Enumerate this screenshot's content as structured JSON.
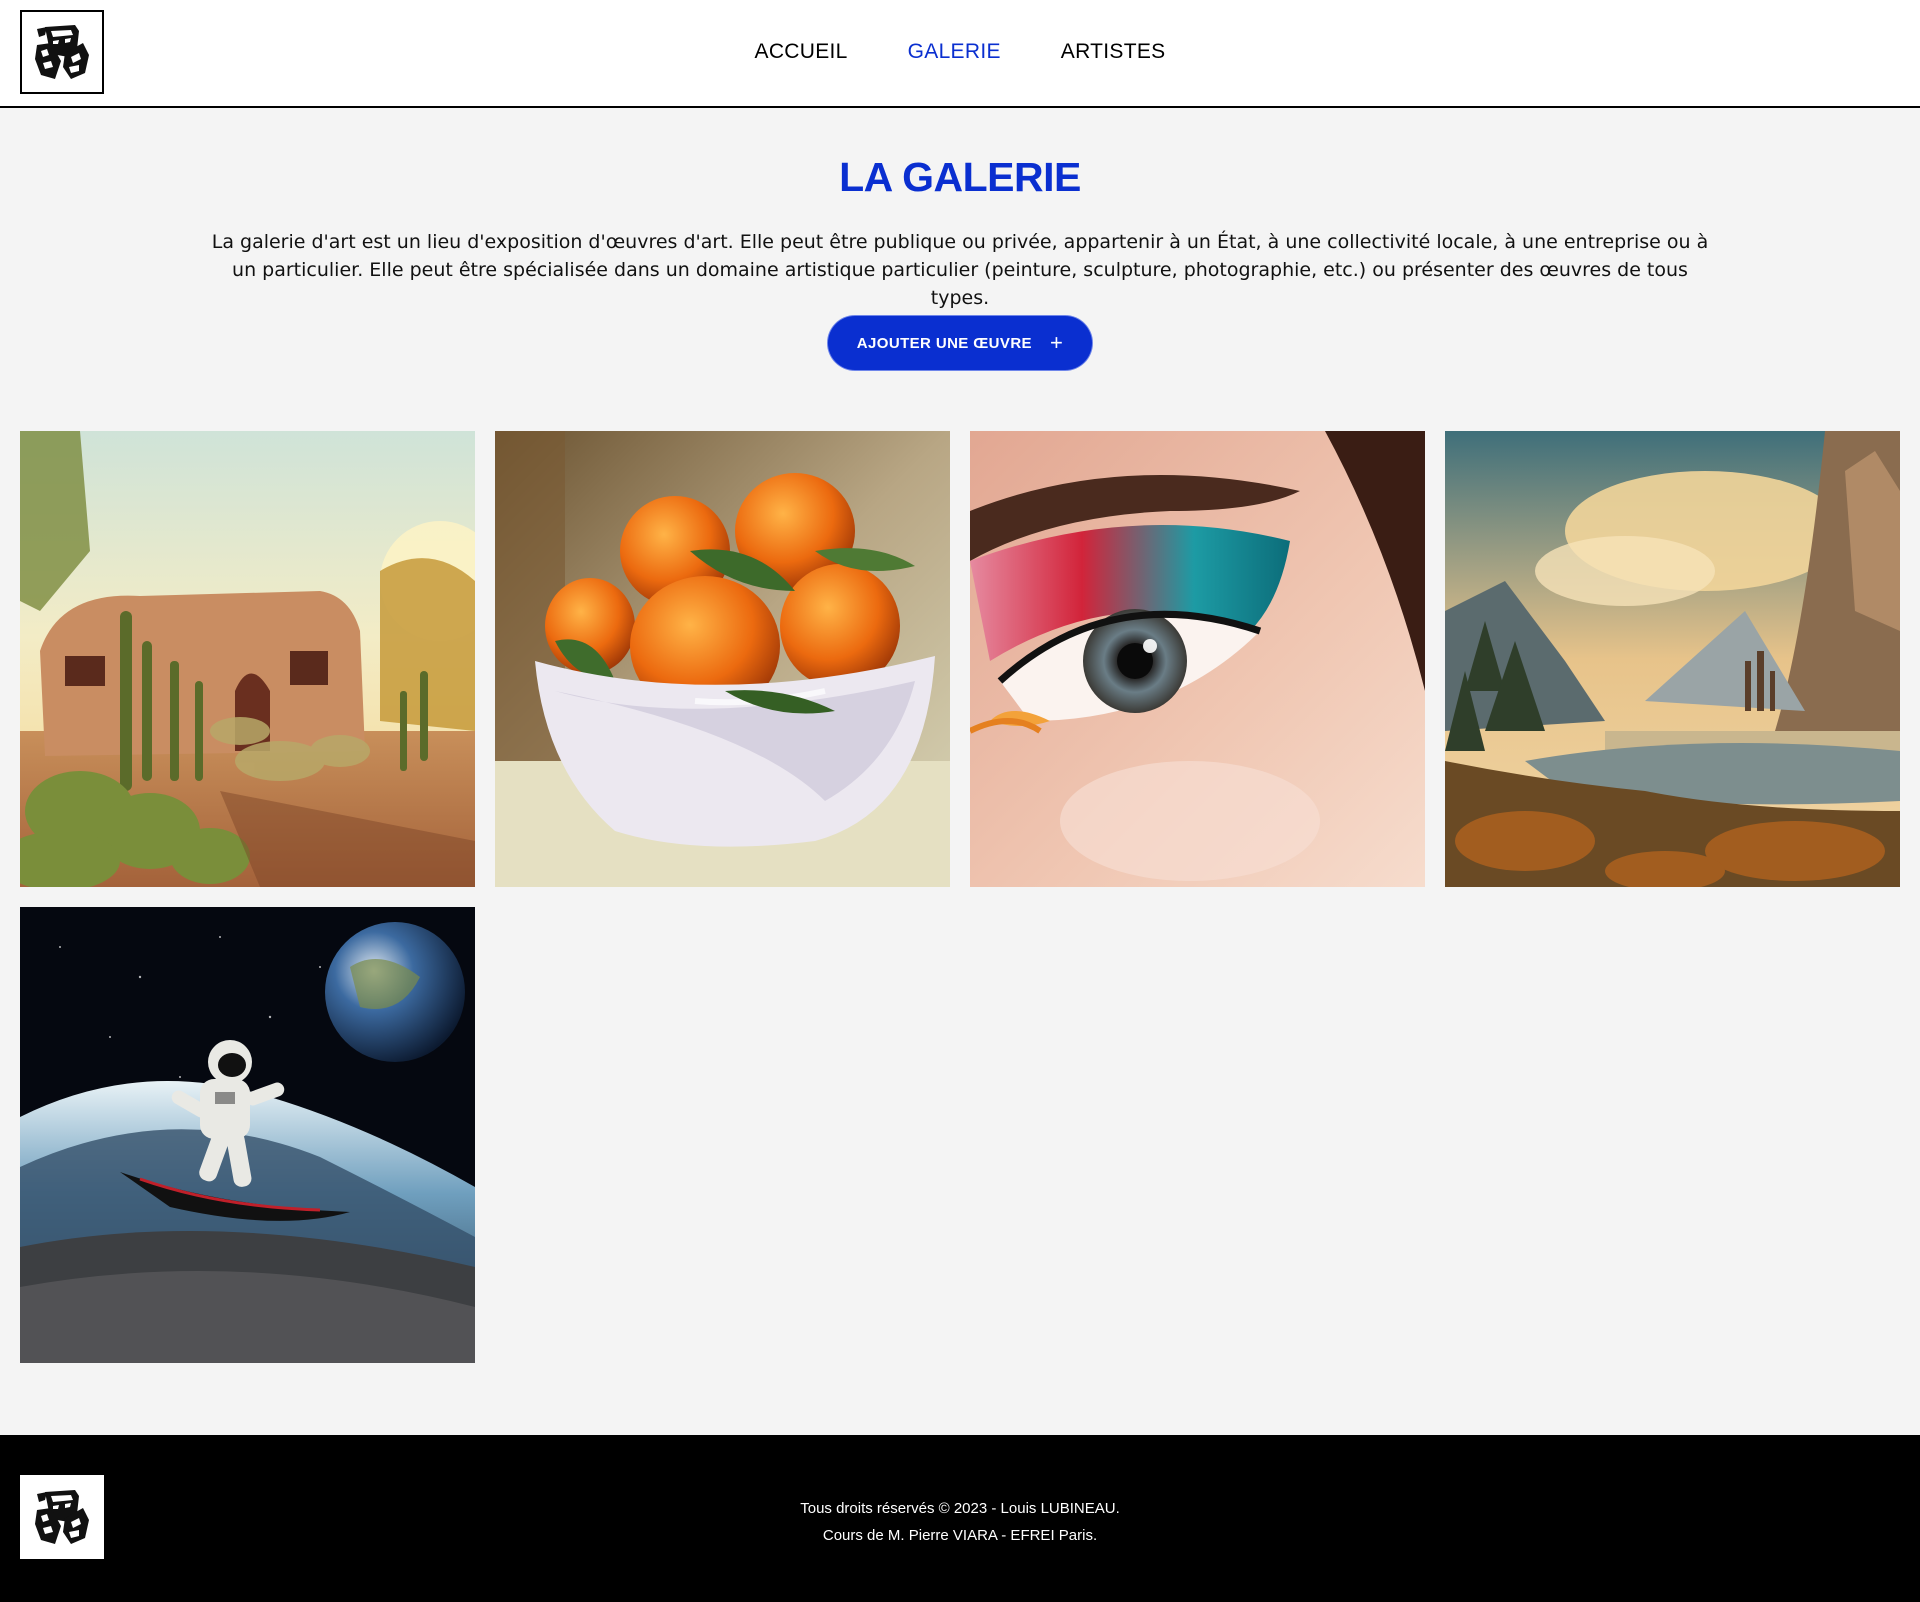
{
  "header": {
    "logo_icon": "theatre-masks-hands-logo",
    "nav": [
      {
        "label": "ACCUEIL",
        "active": false
      },
      {
        "label": "GALERIE",
        "active": true
      },
      {
        "label": "ARTISTES",
        "active": false
      }
    ]
  },
  "main": {
    "title": "LA GALERIE",
    "intro": "La galerie d'art est un lieu d'exposition d'œuvres d'art. Elle peut être publique ou privée, appartenir à un État, à une collectivité locale, à une entreprise ou à un particulier. Elle peut être spécialisée dans un domaine artistique particulier (peinture, sculpture, photographie, etc.) ou présenter des œuvres de tous types.",
    "add_button": {
      "label": "AJOUTER UNE ŒUVRE",
      "icon": "plus-icon"
    }
  },
  "gallery": {
    "artworks": [
      {
        "subject": "desert-adobe-house-with-cacti"
      },
      {
        "subject": "oranges-in-white-bowl-painting"
      },
      {
        "subject": "eye-with-colorful-makeup"
      },
      {
        "subject": "mountain-valley-landscape-with-castle"
      },
      {
        "subject": "astronaut-surfing-wave-with-earth"
      }
    ]
  },
  "footer": {
    "line1": "Tous droits réservés © 2023 - Louis LUBINEAU.",
    "line2": "Cours de M. Pierre VIARA - EFREI Paris."
  },
  "colors": {
    "accent": "#0a2fd0",
    "footer_bg": "#000000",
    "page_bg": "#f4f4f4"
  }
}
